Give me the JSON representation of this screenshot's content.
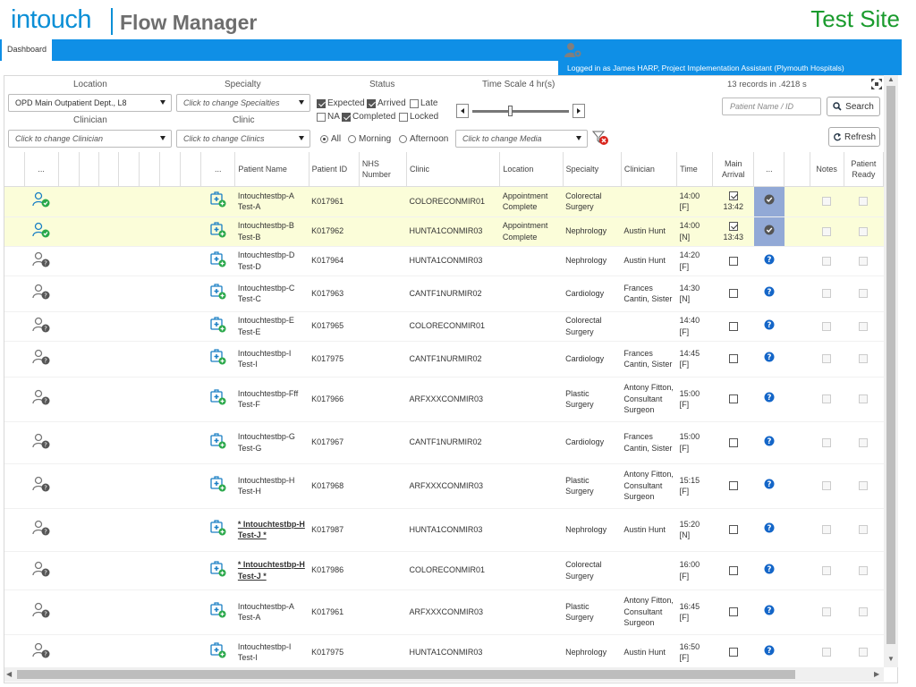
{
  "header": {
    "logo": "intouch",
    "product": "Flow Manager",
    "site": "Test Site"
  },
  "nav": {
    "tab": "Dashboard",
    "user_text": "Logged in as James HARP, Project Implementation Assistant (Plymouth Hospitals)"
  },
  "filters": {
    "location_label": "Location",
    "location_value": "OPD Main Outpatient Dept., L8",
    "specialty_label": "Specialty",
    "specialty_value": "Click to change Specialties",
    "clinician_label": "Clinician",
    "clinician_value": "Click to change Clinician",
    "clinic_label": "Clinic",
    "clinic_value": "Click to change Clinics",
    "status_label": "Status",
    "status": [
      {
        "label": "Expected",
        "checked": true
      },
      {
        "label": "Arrived",
        "checked": true
      },
      {
        "label": "Late",
        "checked": false
      },
      {
        "label": "NA",
        "checked": false
      },
      {
        "label": "Completed",
        "checked": true
      },
      {
        "label": "Locked",
        "checked": false
      }
    ],
    "time_scale_label": "Time Scale",
    "time_scale_value": "4",
    "time_scale_unit": "hr(s)",
    "session": [
      {
        "label": "All",
        "selected": true
      },
      {
        "label": "Morning",
        "selected": false
      },
      {
        "label": "Afternoon",
        "selected": false
      }
    ],
    "media_value": "Click to change Media",
    "records": "13 records in .4218 s",
    "search_placeholder": "Patient Name / ID",
    "search_button": "Search",
    "refresh_button": "Refresh"
  },
  "table": {
    "headers": [
      "...",
      "...",
      "Patient Name",
      "Patient ID",
      "NHS Number",
      "Clinic",
      "Location",
      "Specialty",
      "Clinician",
      "Time",
      "Main Arrival",
      "...",
      "Notes",
      "Patient Ready"
    ],
    "rows": [
      {
        "status": "arrived",
        "name": "Intouchtestbp-A Test-A",
        "bold": false,
        "id": "K017961",
        "clinic": "COLORECONMIR01",
        "location": "Appointment Complete",
        "specialty": "Colorectal Surgery",
        "clinician": "",
        "time": "14:00 [F]",
        "arrived": true,
        "arrival_time": "13:42",
        "highlight": true
      },
      {
        "status": "arrived",
        "name": "Intouchtestbp-B Test-B",
        "bold": false,
        "id": "K017962",
        "clinic": "HUNTA1CONMIR03",
        "location": "Appointment Complete",
        "specialty": "Nephrology",
        "clinician": "Austin Hunt",
        "time": "14:00 [N]",
        "arrived": true,
        "arrival_time": "13:43",
        "highlight": true
      },
      {
        "status": "unknown",
        "name": "Intouchtestbp-D Test-D",
        "bold": false,
        "id": "K017964",
        "clinic": "HUNTA1CONMIR03",
        "location": "",
        "specialty": "Nephrology",
        "clinician": "Austin Hunt",
        "time": "14:20 [F]",
        "arrived": false,
        "arrival_time": "",
        "highlight": false
      },
      {
        "status": "unknown",
        "name": "Intouchtestbp-C Test-C",
        "bold": false,
        "id": "K017963",
        "clinic": "CANTF1NURMIR02",
        "location": "",
        "specialty": "Cardiology",
        "clinician": "Frances Cantin, Sister",
        "time": "14:30 [N]",
        "arrived": false,
        "arrival_time": "",
        "highlight": false
      },
      {
        "status": "unknown",
        "name": "Intouchtestbp-E Test-E",
        "bold": false,
        "id": "K017965",
        "clinic": "COLORECONMIR01",
        "location": "",
        "specialty": "Colorectal Surgery",
        "clinician": "",
        "time": "14:40 [F]",
        "arrived": false,
        "arrival_time": "",
        "highlight": false
      },
      {
        "status": "unknown",
        "name": "Intouchtestbp-I Test-I",
        "bold": false,
        "id": "K017975",
        "clinic": "CANTF1NURMIR02",
        "location": "",
        "specialty": "Cardiology",
        "clinician": "Frances Cantin, Sister",
        "time": "14:45 [F]",
        "arrived": false,
        "arrival_time": "",
        "highlight": false
      },
      {
        "status": "unknown",
        "name": "Intouchtestbp-Fff Test-F",
        "bold": false,
        "id": "K017966",
        "clinic": "ARFXXXCONMIR03",
        "location": "",
        "specialty": "Plastic Surgery",
        "clinician": "Antony Fitton, Consultant Surgeon",
        "time": "15:00 [F]",
        "arrived": false,
        "arrival_time": "",
        "highlight": false
      },
      {
        "status": "unknown",
        "name": "Intouchtestbp-G Test-G",
        "bold": false,
        "id": "K017967",
        "clinic": "CANTF1NURMIR02",
        "location": "",
        "specialty": "Cardiology",
        "clinician": "Frances Cantin, Sister",
        "time": "15:00 [F]",
        "arrived": false,
        "arrival_time": "",
        "highlight": false
      },
      {
        "status": "unknown",
        "name": "Intouchtestbp-H Test-H",
        "bold": false,
        "id": "K017968",
        "clinic": "ARFXXXCONMIR03",
        "location": "",
        "specialty": "Plastic Surgery",
        "clinician": "Antony Fitton, Consultant Surgeon",
        "time": "15:15 [F]",
        "arrived": false,
        "arrival_time": "",
        "highlight": false
      },
      {
        "status": "unknown",
        "name": "* Intouchtestbp-H Test-J *",
        "bold": true,
        "id": "K017987",
        "clinic": "HUNTA1CONMIR03",
        "location": "",
        "specialty": "Nephrology",
        "clinician": "Austin Hunt",
        "time": "15:20 [N]",
        "arrived": false,
        "arrival_time": "",
        "highlight": false
      },
      {
        "status": "unknown",
        "name": "* Intouchtestbp-H Test-J *",
        "bold": true,
        "id": "K017986",
        "clinic": "COLORECONMIR01",
        "location": "",
        "specialty": "Colorectal Surgery",
        "clinician": "",
        "time": "16:00 [F]",
        "arrived": false,
        "arrival_time": "",
        "highlight": false
      },
      {
        "status": "unknown",
        "name": "Intouchtestbp-A Test-A",
        "bold": false,
        "id": "K017961",
        "clinic": "ARFXXXCONMIR03",
        "location": "",
        "specialty": "Plastic Surgery",
        "clinician": "Antony Fitton, Consultant Surgeon",
        "time": "16:45 [F]",
        "arrived": false,
        "arrival_time": "",
        "highlight": false
      },
      {
        "status": "unknown",
        "name": "Intouchtestbp-I Test-I",
        "bold": false,
        "id": "K017975",
        "clinic": "HUNTA1CONMIR03",
        "location": "",
        "specialty": "Nephrology",
        "clinician": "Austin Hunt",
        "time": "16:50 [F]",
        "arrived": false,
        "arrival_time": "",
        "highlight": false
      }
    ]
  },
  "colors": {
    "brand": "#0b8fd6",
    "navbar": "#0f8fe6",
    "test_site": "#1a9b2d",
    "highlight_row": "#fbfdd9",
    "arrived_icon": "#2aa84a",
    "help_icon": "#1466c8"
  }
}
